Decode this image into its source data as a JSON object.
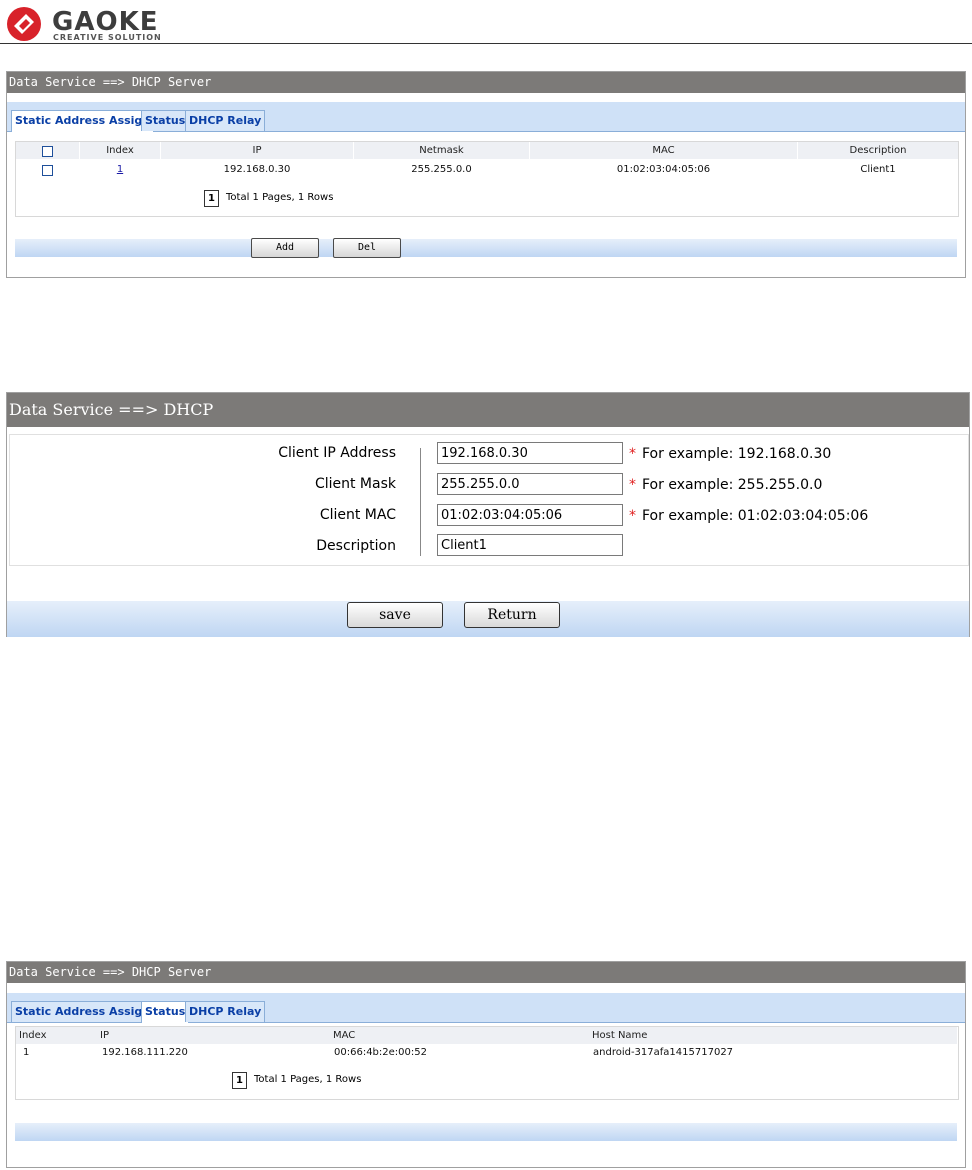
{
  "brand": {
    "name": "GAOKE",
    "tagline": "CREATIVE SOLUTION"
  },
  "panel1": {
    "title": "Data Service ==> DHCP Server",
    "tabs": [
      "Static Address Assign",
      "Status",
      "DHCP Relay"
    ],
    "active_tab": "Static Address Assign",
    "columns": [
      "Index",
      "IP",
      "Netmask",
      "MAC",
      "Description"
    ],
    "rows": [
      {
        "index": "1",
        "ip": "192.168.0.30",
        "netmask": "255.255.0.0",
        "mac": "01:02:03:04:05:06",
        "description": "Client1"
      }
    ],
    "page_current": "1",
    "page_info": "Total 1 Pages, 1 Rows",
    "add_label": "Add",
    "del_label": "Del"
  },
  "panel2": {
    "title": "Data Service ==> DHCP",
    "fields": [
      {
        "label": "Client IP Address",
        "value": "192.168.0.30",
        "hint": "For example: 192.168.0.30",
        "required": true
      },
      {
        "label": "Client Mask",
        "value": "255.255.0.0",
        "hint": "For example: 255.255.0.0",
        "required": true
      },
      {
        "label": "Client MAC",
        "value": "01:02:03:04:05:06",
        "hint": "For example: 01:02:03:04:05:06",
        "required": true
      },
      {
        "label": "Description",
        "value": "Client1",
        "hint": "",
        "required": false
      }
    ],
    "required_marker": "*",
    "save_label": "save",
    "return_label": "Return"
  },
  "panel3": {
    "title": "Data Service ==> DHCP Server",
    "tabs": [
      "Static Address Assign",
      "Status",
      "DHCP Relay"
    ],
    "active_tab": "Status",
    "columns": [
      "Index",
      "IP",
      "MAC",
      "Host Name"
    ],
    "rows": [
      {
        "index": "1",
        "ip": "192.168.111.220",
        "mac": "00:66:4b:2e:00:52",
        "host": "android-317afa1415717027"
      }
    ],
    "page_current": "1",
    "page_info": "Total 1 Pages, 1 Rows"
  },
  "colors": {
    "titlebar": "#7c7a78",
    "tab_text": "#0a3fa6",
    "required": "#e02020",
    "link": "#1a1aa6",
    "brand_red": "#d8222a"
  }
}
